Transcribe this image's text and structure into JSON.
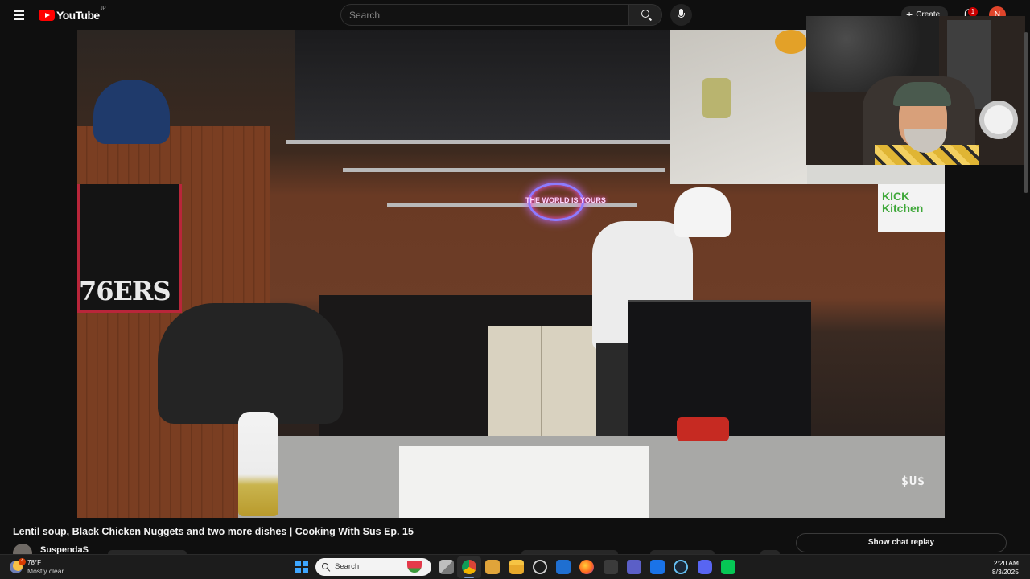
{
  "youtube": {
    "logo_text": "YouTube",
    "region": "JP",
    "search_placeholder": "Search",
    "create_label": "Create",
    "notification_count": "1",
    "avatar_initial": "N"
  },
  "video": {
    "title": "Lentil soup, Black Chicken Nuggets and two more dishes | Cooking With Sus Ep. 15",
    "neon_sign_text": "THE WORLD IS YOURS",
    "jersey_text": "76ERS",
    "sign_text": "KICK\nKitchen",
    "watermark": "$U$"
  },
  "channel": {
    "name": "SuspendaS"
  },
  "chat": {
    "replay_label": "Show chat replay"
  },
  "taskbar": {
    "weather_temp": "78°F",
    "weather_desc": "Mostly clear",
    "weather_badge": "4",
    "search_label": "Search",
    "time": "2:20 AM",
    "date": "8/3/2025",
    "apps": [
      "task-view",
      "chrome",
      "notes",
      "file-explorer",
      "copilot",
      "remote",
      "firefox",
      "media-player",
      "teams",
      "outlook",
      "steam",
      "discord",
      "line"
    ]
  },
  "colors": {
    "youtube_red": "#ff0000",
    "background": "#0f0f0f",
    "taskbar": "#1c1c1c",
    "accent_blue": "#3ea6ff"
  }
}
